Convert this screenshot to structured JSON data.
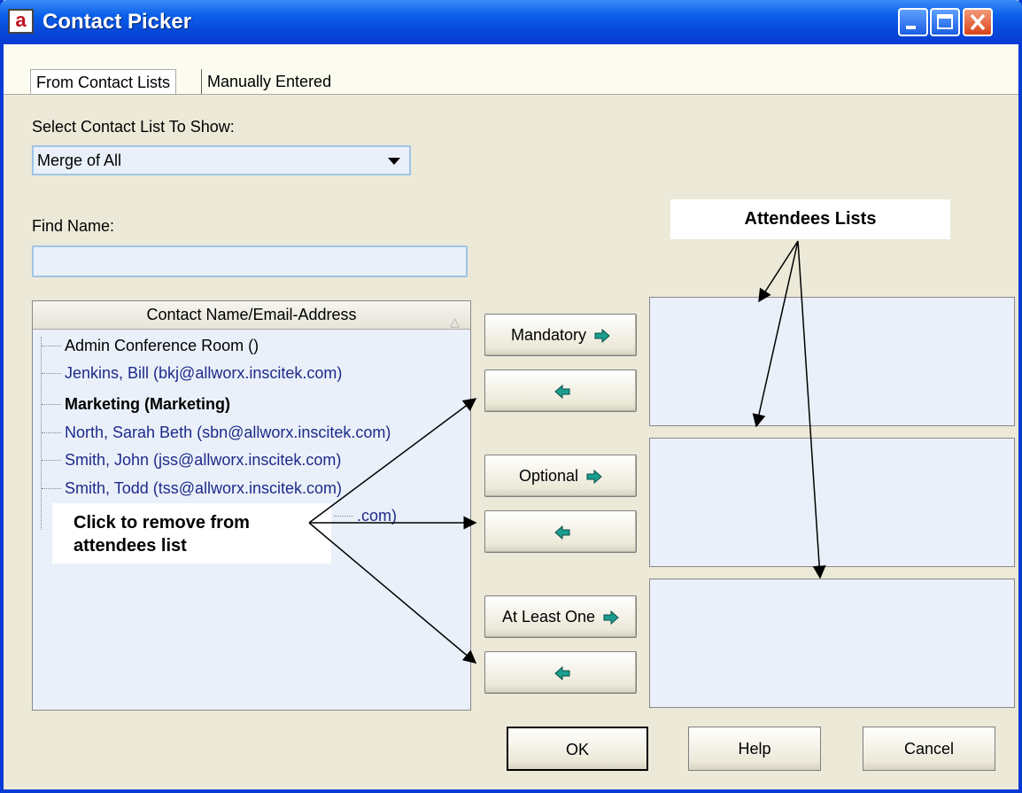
{
  "window": {
    "title": "Contact Picker",
    "app_icon_letter": "a"
  },
  "tabs": [
    {
      "label": "From Contact Lists",
      "active": true
    },
    {
      "label": "Manually Entered",
      "active": false
    }
  ],
  "select_list": {
    "label": "Select Contact List To Show:",
    "value": "Merge of All"
  },
  "find_name": {
    "label": "Find Name:",
    "value": ""
  },
  "contacts": {
    "header": "Contact Name/Email-Address",
    "sort_indicator": "△",
    "items": [
      {
        "text": "Admin Conference Room ()",
        "style": "black"
      },
      {
        "text": "Jenkins, Bill (bkj@allworx.inscitek.com)",
        "style": "blue"
      },
      {
        "text": "Marketing (Marketing)",
        "style": "bold"
      },
      {
        "text": "North, Sarah Beth (sbn@allworx.inscitek.com)",
        "style": "blue"
      },
      {
        "text": "Smith, John (jss@allworx.inscitek.com)",
        "style": "blue"
      },
      {
        "text": "Smith, Todd (tss@allworx.inscitek.com)",
        "style": "blue"
      },
      {
        "text": ".com)",
        "style": "blue"
      }
    ]
  },
  "attendee_buttons": {
    "mandatory": "Mandatory",
    "optional": "Optional",
    "at_least_one": "At Least One"
  },
  "footer": {
    "ok": "OK",
    "help": "Help",
    "cancel": "Cancel"
  },
  "annotations": {
    "attendees_lists": "Attendees Lists",
    "remove_line1": "Click to remove from",
    "remove_line2": "attendees list"
  },
  "colors": {
    "arrow_fill": "#1a9e8f",
    "title_bar": "#0a5fea",
    "list_bg": "#eaf0f9"
  }
}
